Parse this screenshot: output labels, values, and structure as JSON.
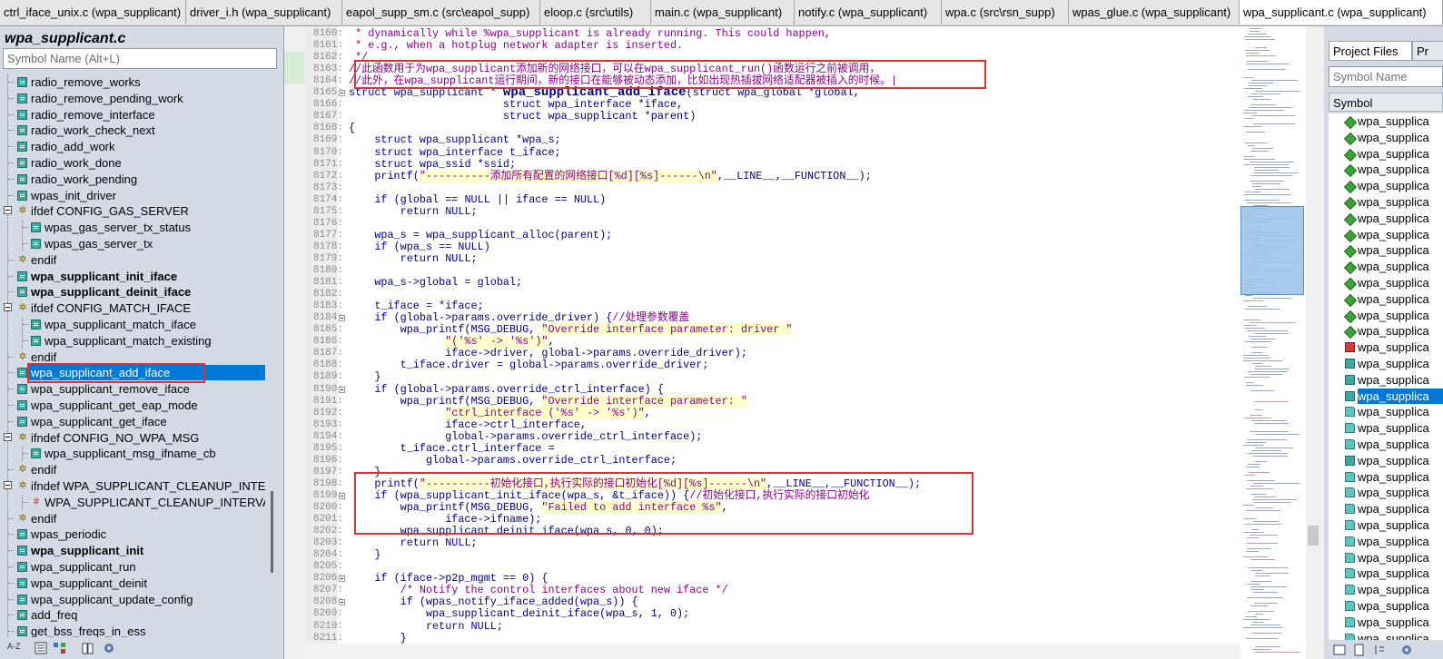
{
  "tabs": [
    {
      "label": "ctrl_iface_unix.c (wpa_supplicant)",
      "w": 205
    },
    {
      "label": "driver_i.h (wpa_supplicant)",
      "w": 172
    },
    {
      "label": "eapol_supp_sm.c (src\\eapol_supp)",
      "w": 218
    },
    {
      "label": "eloop.c (src\\utils)",
      "w": 122
    },
    {
      "label": "main.c (wpa_supplicant)",
      "w": 158
    },
    {
      "label": "notify.c (wpa_supplicant)",
      "w": 162
    },
    {
      "label": "wpa.c (src\\rsn_supp)",
      "w": 140
    },
    {
      "label": "wpas_glue.c (wpa_supplicant)",
      "w": 188
    },
    {
      "label": "wpa_supplicant.c (wpa_supplicant)",
      "w": 224,
      "active": true
    }
  ],
  "left_panel": {
    "title": "wpa_supplicant.c",
    "search_placeholder": "Symbol Name (Alt+L)",
    "tree": [
      {
        "label": "radio_remove_works",
        "indent": 0,
        "icon": "func"
      },
      {
        "label": "radio_remove_pending_work",
        "indent": 0,
        "icon": "func"
      },
      {
        "label": "radio_remove_interface",
        "indent": 0,
        "icon": "func"
      },
      {
        "label": "radio_work_check_next",
        "indent": 0,
        "icon": "func"
      },
      {
        "label": "radio_add_work",
        "indent": 0,
        "icon": "func"
      },
      {
        "label": "radio_work_done",
        "indent": 0,
        "icon": "func"
      },
      {
        "label": "radio_work_pending",
        "indent": 0,
        "icon": "func"
      },
      {
        "label": "wpas_init_driver",
        "indent": 0,
        "icon": "func"
      },
      {
        "label": "ifdef CONFIG_GAS_SERVER",
        "indent": 0,
        "icon": "cond",
        "expander": true
      },
      {
        "label": "wpas_gas_server_tx_status",
        "indent": 1,
        "icon": "func"
      },
      {
        "label": "wpas_gas_server_tx",
        "indent": 1,
        "icon": "func"
      },
      {
        "label": "endif",
        "indent": 0,
        "icon": "cond"
      },
      {
        "label": "wpa_supplicant_init_iface",
        "indent": 0,
        "icon": "func",
        "bold": true
      },
      {
        "label": "wpa_supplicant_deinit_iface",
        "indent": 0,
        "icon": "func",
        "bold": true
      },
      {
        "label": "ifdef CONFIG_MATCH_IFACE",
        "indent": 0,
        "icon": "cond",
        "expander": true
      },
      {
        "label": "wpa_supplicant_match_iface",
        "indent": 1,
        "icon": "func"
      },
      {
        "label": "wpa_supplicant_match_existing",
        "indent": 1,
        "icon": "func"
      },
      {
        "label": "endif",
        "indent": 0,
        "icon": "cond"
      },
      {
        "label": "wpa_supplicant_add_iface",
        "indent": 0,
        "icon": "func",
        "selected": true
      },
      {
        "label": "wpa_supplicant_remove_iface",
        "indent": 0,
        "icon": "func"
      },
      {
        "label": "wpa_supplicant_get_eap_mode",
        "indent": 0,
        "icon": "func"
      },
      {
        "label": "wpa_supplicant_get_iface",
        "indent": 0,
        "icon": "func"
      },
      {
        "label": "ifndef CONFIG_NO_WPA_MSG",
        "indent": 0,
        "icon": "cond",
        "expander": true
      },
      {
        "label": "wpa_supplicant_msg_ifname_cb",
        "indent": 1,
        "icon": "func"
      },
      {
        "label": "endif",
        "indent": 0,
        "icon": "cond"
      },
      {
        "label": "ifndef WPA_SUPPLICANT_CLEANUP_INTERVA",
        "indent": 0,
        "icon": "cond",
        "expander": true
      },
      {
        "label": "WPA_SUPPLICANT_CLEANUP_INTERVAL",
        "indent": 1,
        "icon": "hash"
      },
      {
        "label": "endif",
        "indent": 0,
        "icon": "cond"
      },
      {
        "label": "wpas_periodic",
        "indent": 0,
        "icon": "func"
      },
      {
        "label": "wpa_supplicant_init",
        "indent": 0,
        "icon": "func",
        "bold": true
      },
      {
        "label": "wpa_supplicant_run",
        "indent": 0,
        "icon": "func"
      },
      {
        "label": "wpa_supplicant_deinit",
        "indent": 0,
        "icon": "func"
      },
      {
        "label": "wpa_supplicant_update_config",
        "indent": 0,
        "icon": "func"
      },
      {
        "label": "add_freq",
        "indent": 0,
        "icon": "func"
      },
      {
        "label": "get_bss_freqs_in_ess",
        "indent": 0,
        "icon": "func"
      }
    ],
    "bottom_icons": [
      "sort-az-icon",
      "symbol-list-icon",
      "tree-icon",
      "book-icon",
      "gear-icon"
    ],
    "bottom_sort_label": "A-Z"
  },
  "editor": {
    "lines": [
      {
        "n": "8160:",
        "t": " * dynamically while %wpa_supplicant is already running. This could happen,",
        "c": "cm"
      },
      {
        "n": "8161:",
        "t": " * e.g., when a hotplug network adapter is inserted.",
        "c": "cm"
      },
      {
        "n": "8162:",
        "t": " */",
        "c": "cm"
      },
      {
        "n": "8163:",
        "t": "//此函数用于为wpa_supplicant添加新的网络接口，可以在wpa_supplicant_run()函数运行之前被调用，",
        "c": "cm"
      },
      {
        "n": "8164:",
        "t": "//此外，在wpa_supplicant运行期间，新的接口在能够被动态添加，比如出现热插拔网络适配器被插入的时候。|",
        "c": "cm"
      },
      {
        "n": "8165:",
        "t": "struct wpa_supplicant * wpa_supplicant_add_iface(struct wpa_global *global,",
        "c": "decl",
        "fold": true
      },
      {
        "n": "8166:",
        "t": "                        struct wpa_interface *iface,",
        "c": ""
      },
      {
        "n": "8167:",
        "t": "                        struct wpa_supplicant *parent)",
        "c": ""
      },
      {
        "n": "8168:",
        "t": "{",
        "c": ""
      },
      {
        "n": "8169:",
        "t": "    struct wpa_supplicant *wpa_s;",
        "c": ""
      },
      {
        "n": "8170:",
        "t": "    struct wpa_interface t_iface;",
        "c": ""
      },
      {
        "n": "8171:",
        "t": "    struct wpa_ssid *ssid;",
        "c": ""
      },
      {
        "n": "8172:",
        "t": "    printf(\"----------添加所有配置的网络接口[%d][%s]------\\n\",__LINE__,__FUNCTION__);",
        "c": ""
      },
      {
        "n": "8173:",
        "t": "",
        "c": ""
      },
      {
        "n": "8174:",
        "t": "    if (global == NULL || iface == NULL)",
        "c": ""
      },
      {
        "n": "8175:",
        "t": "        return NULL;",
        "c": ""
      },
      {
        "n": "8176:",
        "t": "",
        "c": ""
      },
      {
        "n": "8177:",
        "t": "    wpa_s = wpa_supplicant_alloc(parent);",
        "c": ""
      },
      {
        "n": "8178:",
        "t": "    if (wpa_s == NULL)",
        "c": ""
      },
      {
        "n": "8179:",
        "t": "        return NULL;",
        "c": ""
      },
      {
        "n": "8180:",
        "t": "",
        "c": ""
      },
      {
        "n": "8181:",
        "t": "    wpa_s->global = global;",
        "c": ""
      },
      {
        "n": "8182:",
        "t": "",
        "c": ""
      },
      {
        "n": "8183:",
        "t": "    t_iface = *iface;",
        "c": ""
      },
      {
        "n": "8184:",
        "t": "    if (global->params.override_driver) {//处理参数覆盖",
        "c": "",
        "fold": true
      },
      {
        "n": "8185:",
        "t": "        wpa_printf(MSG_DEBUG, \"Override interface parameter: driver \"",
        "c": ""
      },
      {
        "n": "8186:",
        "t": "               \"('%s' -> '%s')\",",
        "c": ""
      },
      {
        "n": "8187:",
        "t": "               iface->driver, global->params.override_driver);",
        "c": ""
      },
      {
        "n": "8188:",
        "t": "        t_iface.driver = global->params.override_driver;",
        "c": ""
      },
      {
        "n": "8189:",
        "t": "    }",
        "c": ""
      },
      {
        "n": "8190:",
        "t": "    if (global->params.override_ctrl_interface) {",
        "c": "",
        "fold": true
      },
      {
        "n": "8191:",
        "t": "        wpa_printf(MSG_DEBUG, \"Override interface parameter: \"",
        "c": ""
      },
      {
        "n": "8192:",
        "t": "               \"ctrl_interface ('%s' -> '%s')\",",
        "c": ""
      },
      {
        "n": "8193:",
        "t": "               iface->ctrl_interface,",
        "c": ""
      },
      {
        "n": "8194:",
        "t": "               global->params.override_ctrl_interface);",
        "c": ""
      },
      {
        "n": "8195:",
        "t": "        t_iface.ctrl_interface =",
        "c": ""
      },
      {
        "n": "8196:",
        "t": "            global->params.override_ctrl_interface;",
        "c": ""
      },
      {
        "n": "8197:",
        "t": "    }",
        "c": ""
      },
      {
        "n": "8198:",
        "t": "    printf(\"----------初始化接口,执行实际的接口初始化[%d][%s]------\\n\",__LINE__,__FUNCTION__);",
        "c": ""
      },
      {
        "n": "8199:",
        "t": "    if (wpa_supplicant_init_iface(wpa_s, &t_iface)) {//初始化接口,执行实际的接口初始化",
        "c": "",
        "fold": true
      },
      {
        "n": "8200:",
        "t": "        wpa_printf(MSG_DEBUG, \"Failed to add interface %s\",",
        "c": ""
      },
      {
        "n": "8201:",
        "t": "               iface->ifname);",
        "c": ""
      },
      {
        "n": "8202:",
        "t": "        wpa_supplicant_deinit_iface(wpa_s, 0, 0);",
        "c": ""
      },
      {
        "n": "8203:",
        "t": "        return NULL;",
        "c": ""
      },
      {
        "n": "8204:",
        "t": "    }",
        "c": ""
      },
      {
        "n": "8205:",
        "t": "",
        "c": ""
      },
      {
        "n": "8206:",
        "t": "    if (iface->p2p_mgmt == 0) {",
        "c": "",
        "fold": true
      },
      {
        "n": "8207:",
        "t": "        /* Notify the control interfaces about new iface */",
        "c": ""
      },
      {
        "n": "8208:",
        "t": "        if (wpas_notify_iface_added(wpa_s)) {",
        "c": "",
        "fold": true
      },
      {
        "n": "8209:",
        "t": "            wpa_supplicant_deinit_iface(wpa_s, 1, 0);",
        "c": ""
      },
      {
        "n": "8210:",
        "t": "            return NULL;",
        "c": ""
      },
      {
        "n": "8211:",
        "t": "        }",
        "c": ""
      }
    ]
  },
  "right_panel": {
    "tabs": [
      "Project Files",
      "Pr"
    ],
    "search_placeholder": "Symbol Name",
    "header": "Symbol",
    "items": [
      {
        "label": "wpa_supplica",
        "icon": "diamond"
      },
      {
        "label": "wpa_supplica",
        "icon": "diamond"
      },
      {
        "label": "wpa_supplica",
        "icon": "diamond"
      },
      {
        "label": "wpa_supplica",
        "icon": "diamond"
      },
      {
        "label": "wpa_supplica",
        "icon": "diamond"
      },
      {
        "label": "wpa_supplica",
        "icon": "diamond"
      },
      {
        "label": "wpa_supplica",
        "icon": "diamond"
      },
      {
        "label": "wpa_supplica",
        "icon": "diamond"
      },
      {
        "label": "wpa_supplica",
        "icon": "diamond"
      },
      {
        "label": "wpa_supplica",
        "icon": "diamond"
      },
      {
        "label": "wpa_supplica",
        "icon": "diamond"
      },
      {
        "label": "wpa_supplica",
        "icon": "diamond"
      },
      {
        "label": "wpa_supplica",
        "icon": "diamond"
      },
      {
        "label": "wpa_supplica",
        "icon": "diamond"
      },
      {
        "label": "wpa_supplica",
        "icon": "hash"
      },
      {
        "label": "wpa_supplica",
        "icon": "func"
      },
      {
        "label": "wpa_supplica",
        "icon": "func"
      },
      {
        "label": "wpa_supplica",
        "icon": "func",
        "selected": true
      },
      {
        "label": "wpa_supplica",
        "icon": "teal2"
      },
      {
        "label": "wpa_supplica",
        "icon": "teal2"
      },
      {
        "label": "wpa_supplica",
        "icon": "teal2"
      },
      {
        "label": "wpa_supplica",
        "icon": "func"
      },
      {
        "label": "wpa_supplica",
        "icon": "teal2"
      },
      {
        "label": "wpa_supplica",
        "icon": "teal2"
      },
      {
        "label": "wpa_supplica",
        "icon": "teal2"
      },
      {
        "label": "wpa_supplica",
        "icon": "teal2"
      },
      {
        "label": "wpa_supplica",
        "icon": "teal2"
      },
      {
        "label": "wpa_supplica",
        "icon": "teal2"
      },
      {
        "label": "wpa_supplica",
        "icon": "teal2"
      },
      {
        "label": "wpa_supplica",
        "icon": "teal2"
      },
      {
        "label": "wpa_supplica",
        "icon": "teal2"
      },
      {
        "label": "wpa_supplica",
        "icon": "teal2"
      },
      {
        "label": "wpa_supplica",
        "icon": "teal2"
      },
      {
        "label": "wpa_supplica",
        "icon": "teal2"
      }
    ]
  },
  "colors": {
    "accent": "#0078d7",
    "annotation": "#e03030",
    "panel_bg": "#d4dbe5"
  }
}
